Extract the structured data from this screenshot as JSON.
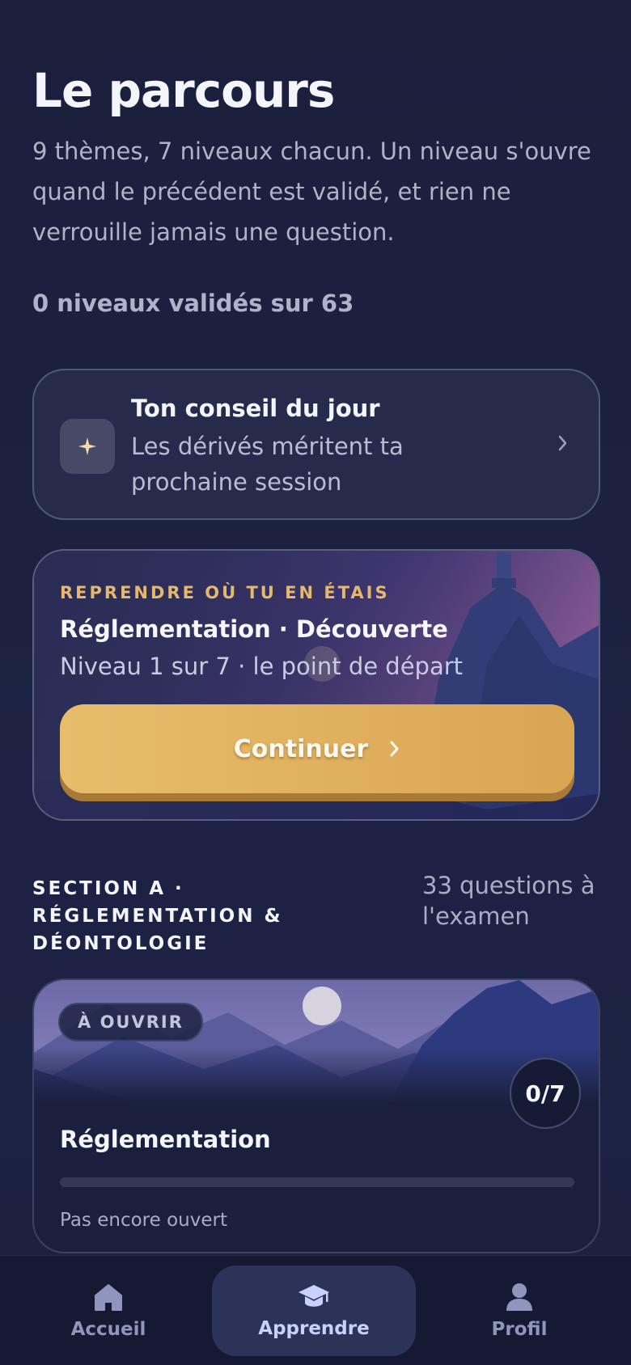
{
  "header": {
    "title": "Le parcours",
    "subtitle": "9 thèmes, 7 niveaux chacun. Un niveau s'ouvre quand le précédent est validé, et rien ne verrouille jamais une question.",
    "progress_summary": "0 niveaux validés sur 63"
  },
  "tip": {
    "title": "Ton conseil du jour",
    "text": "Les dérivés méritent ta prochaine session",
    "icon": "sparkle-icon"
  },
  "resume": {
    "kicker": "REPRENDRE OÙ TU EN ÉTAIS",
    "title": "Réglementation · Découverte",
    "subtitle": "Niveau 1 sur 7 · le point de départ",
    "button_label": "Continuer"
  },
  "section": {
    "title": "SECTION A · RÉGLEMENTATION & DÉONTOLOGIE",
    "count": "33 questions à l'examen"
  },
  "theme_card": {
    "badge": "À OUVRIR",
    "level_count": "0/7",
    "progress": 0,
    "name": "Réglementation",
    "status": "Pas encore ouvert"
  },
  "nav": {
    "items": [
      {
        "label": "Accueil",
        "icon": "home-icon",
        "active": false
      },
      {
        "label": "Apprendre",
        "icon": "graduation-cap-icon",
        "active": true
      },
      {
        "label": "Profil",
        "icon": "user-icon",
        "active": false
      }
    ]
  },
  "colors": {
    "background": "#1c2140",
    "accent_gold": "#e5b86b",
    "nav_active": "#c9d2ff"
  }
}
